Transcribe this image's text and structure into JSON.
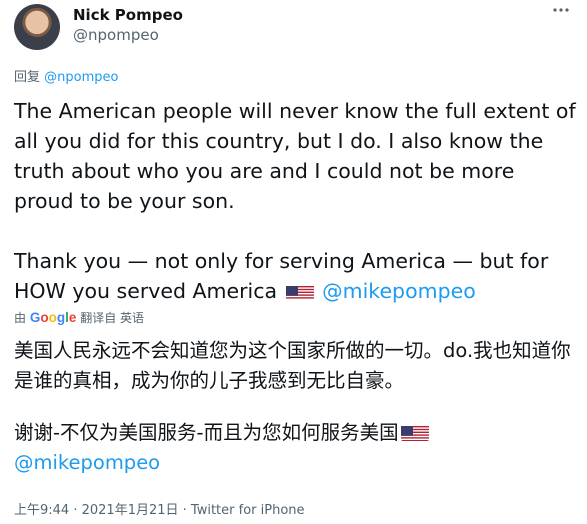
{
  "author": {
    "name": "Nick Pompeo",
    "handle": "@npompeo"
  },
  "more_icon": "more-options-icon",
  "reply": {
    "prefix": "回复",
    "mention": "@npompeo"
  },
  "tweet": {
    "paragraph1": "The American people will never know the full extent of all you did for this country, but I do. I also know the truth about who you are and I could not be more proud to be your son.",
    "paragraph2_text": "Thank you — not only for serving America — but for HOW you served America",
    "paragraph2_flag": "us-flag-icon",
    "paragraph2_mention": "@mikepompeo"
  },
  "translation": {
    "by": "由",
    "provider": "Google",
    "label": "翻译自 英语",
    "paragraph1": "美国人民永远不会知道您为这个国家所做的一切。do.我也知道你是谁的真相，成为你的儿子我感到无比自豪。",
    "paragraph2_text": "谢谢-不仅为美国服务-而且为您如何服务美国",
    "paragraph2_flag": "us-flag-icon",
    "paragraph2_mention": "@mikepompeo"
  },
  "meta": {
    "time": "上午9:44",
    "separator1": " · ",
    "date": "2021年1月21日",
    "separator2": " · ",
    "source": "Twitter for iPhone"
  },
  "colors": {
    "link": "#1d9bf0",
    "secondary": "#536471",
    "text": "#0f1419"
  }
}
